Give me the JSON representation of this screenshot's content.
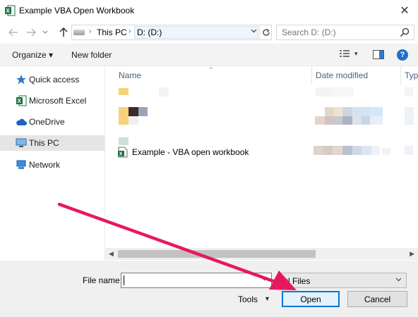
{
  "window": {
    "title": "Example VBA Open Workbook",
    "close_glyph": "✕"
  },
  "address": {
    "crumbs": [
      "This PC",
      "D: (D:)"
    ],
    "search_placeholder": "Search D: (D:)"
  },
  "toolbar": {
    "organize_label": "Organize ▾",
    "new_folder_label": "New folder",
    "help_glyph": "?"
  },
  "sidebar": {
    "items": [
      {
        "label": "Quick access",
        "icon": "star-icon"
      },
      {
        "label": "Microsoft Excel",
        "icon": "excel-icon"
      },
      {
        "label": "OneDrive",
        "icon": "cloud-icon"
      },
      {
        "label": "This PC",
        "icon": "computer-icon",
        "selected": true
      },
      {
        "label": "Network",
        "icon": "network-icon"
      }
    ]
  },
  "filelist": {
    "columns": [
      "Name",
      "Date modified",
      "Typ"
    ],
    "files": [
      {
        "name": "Example - VBA open workbook",
        "icon": "excel-file-icon"
      }
    ]
  },
  "bottom": {
    "file_name_label": "File name:",
    "file_name_value": "",
    "filter_value": "xl Files",
    "tools_label": "Tools",
    "open_label": "Open",
    "cancel_label": "Cancel"
  },
  "colors": {
    "accent": "#0078d7",
    "annotation_arrow": "#e8185f",
    "excel_green": "#1d7044"
  }
}
